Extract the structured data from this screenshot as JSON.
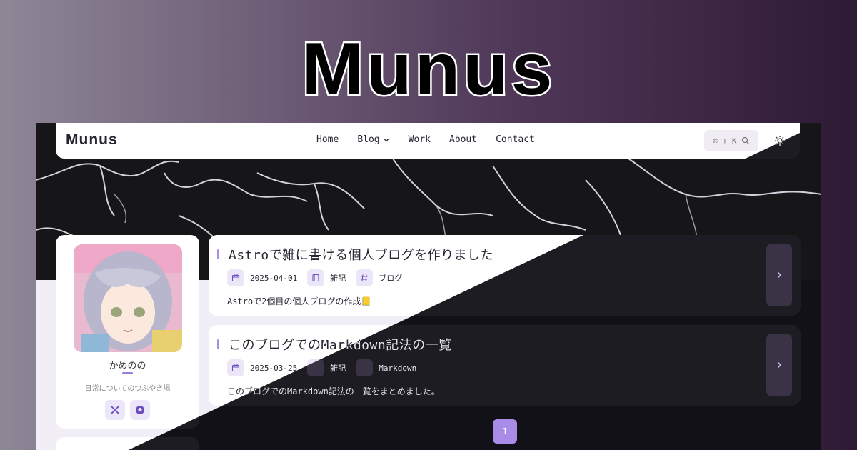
{
  "hero": {
    "title": "Munus"
  },
  "navbar": {
    "logo": "Munus",
    "links": [
      "Home",
      "Blog",
      "Work",
      "About",
      "Contact"
    ],
    "search_hint": "⌘ + K"
  },
  "profile": {
    "name": "かめのの",
    "description": "日常についてのつぶやき場"
  },
  "posts": [
    {
      "title": "Astroで雑に書ける個人ブログを作りました",
      "date": "2025-04-01",
      "category": "雑記",
      "tag": "ブログ",
      "excerpt": "Astroで2個目の個人ブログの作成📒"
    },
    {
      "title": "このブログでのMarkdown記法の一覧",
      "date": "2025-03-25",
      "category": "雑記",
      "tag": "Markdown",
      "excerpt": "このブログでのMarkdown記法の一覧をまとめました。"
    }
  ],
  "pagination": {
    "current": "1"
  },
  "colors": {
    "accent": "#a98be8",
    "chip": "#ece7f8",
    "dark_bg": "#121117"
  },
  "icons": [
    "calendar-icon",
    "book-icon",
    "hash-icon",
    "chevron-right-icon",
    "search-icon",
    "sun-icon",
    "x-logo-icon",
    "github-icon",
    "chevron-down-icon"
  ]
}
